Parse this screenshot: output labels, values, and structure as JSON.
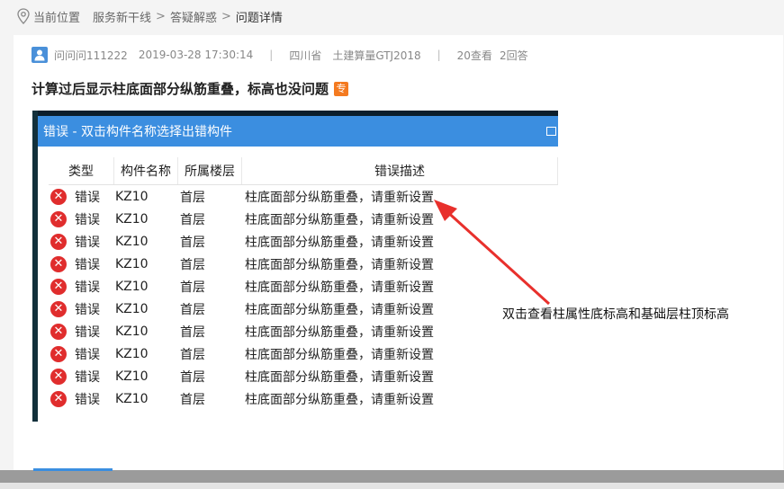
{
  "breadcrumb": {
    "location_label": "当前位置",
    "items": [
      "服务新干线",
      "答疑解惑",
      "问题详情"
    ],
    "separator": ">"
  },
  "question": {
    "user": "问问问111222",
    "datetime": "2019-03-28 17:30:14",
    "region": "四川省",
    "software": "土建算量GTJ2018",
    "views": "20查看",
    "answers": "2回答",
    "title": "计算过后显示柱底面部分纵筋重叠，标高也没问题",
    "tag": "专"
  },
  "screenshot": {
    "window_title": "错误 - 双击构件名称选择出错构件",
    "columns": [
      "类型",
      "构件名称",
      "所属楼层",
      "错误描述"
    ],
    "rows": [
      {
        "type": "错误",
        "name": "KZ10",
        "floor": "首层",
        "desc": "柱底面部分纵筋重叠，请重新设置"
      },
      {
        "type": "错误",
        "name": "KZ10",
        "floor": "首层",
        "desc": "柱底面部分纵筋重叠，请重新设置"
      },
      {
        "type": "错误",
        "name": "KZ10",
        "floor": "首层",
        "desc": "柱底面部分纵筋重叠，请重新设置"
      },
      {
        "type": "错误",
        "name": "KZ10",
        "floor": "首层",
        "desc": "柱底面部分纵筋重叠，请重新设置"
      },
      {
        "type": "错误",
        "name": "KZ10",
        "floor": "首层",
        "desc": "柱底面部分纵筋重叠，请重新设置"
      },
      {
        "type": "错误",
        "name": "KZ10",
        "floor": "首层",
        "desc": "柱底面部分纵筋重叠，请重新设置"
      },
      {
        "type": "错误",
        "name": "KZ10",
        "floor": "首层",
        "desc": "柱底面部分纵筋重叠，请重新设置"
      },
      {
        "type": "错误",
        "name": "KZ10",
        "floor": "首层",
        "desc": "柱底面部分纵筋重叠，请重新设置"
      },
      {
        "type": "错误",
        "name": "KZ10",
        "floor": "首层",
        "desc": "柱底面部分纵筋重叠，请重新设置"
      },
      {
        "type": "错误",
        "name": "KZ10",
        "floor": "首层",
        "desc": "柱底面部分纵筋重叠，请重新设置"
      }
    ]
  },
  "annotation": "双击查看柱属性底标高和基础层柱顶标高",
  "colors": {
    "accent": "#3b8ee0",
    "error": "#e02d2d",
    "tag": "#f47a20",
    "arrow": "#e8302c"
  }
}
